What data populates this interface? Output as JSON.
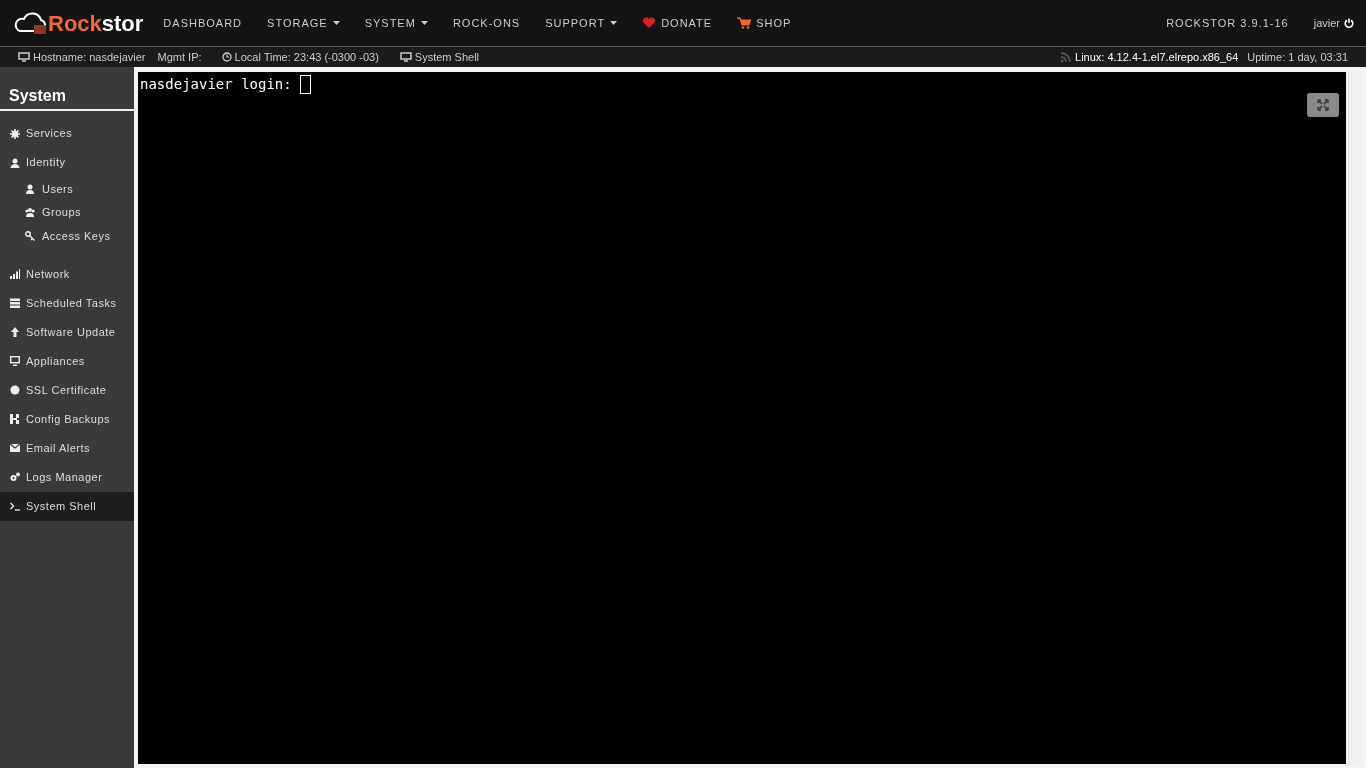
{
  "brand": {
    "name_part_1": "Rock",
    "name_part_2": "stor"
  },
  "nav": [
    {
      "label": "DASHBOARD",
      "has_menu": false
    },
    {
      "label": "STORAGE",
      "has_menu": true
    },
    {
      "label": "SYSTEM",
      "has_menu": true
    },
    {
      "label": "ROCK-ONS",
      "has_menu": false
    },
    {
      "label": "SUPPORT",
      "has_menu": true
    },
    {
      "label": "DONATE",
      "has_menu": false
    },
    {
      "label": "SHOP",
      "has_menu": false
    }
  ],
  "version": "ROCKSTOR 3.9.1-16",
  "user": "javier",
  "status_bar": {
    "hostname": "Hostname: nasdejavier",
    "mgmt_ip": "Mgmt IP:",
    "local_time": "Local Time: 23:43 (-0300 -03)",
    "shell": "System Shell",
    "kernel": "Linux: 4.12.4-1.el7.elrepo.x86_64",
    "uptime": "Uptime: 1 day, 03:31"
  },
  "sidebar": {
    "title": "System",
    "items": [
      {
        "label": "Services",
        "selected": false
      },
      {
        "label": "Identity",
        "selected": false,
        "children": [
          {
            "label": "Users",
            "selected": false
          },
          {
            "label": "Groups",
            "selected": false
          },
          {
            "label": "Access Keys",
            "selected": false
          }
        ]
      },
      {
        "label": "Network",
        "selected": false
      },
      {
        "label": "Scheduled Tasks",
        "selected": false
      },
      {
        "label": "Software Update",
        "selected": false
      },
      {
        "label": "Appliances",
        "selected": false
      },
      {
        "label": "SSL Certificate",
        "selected": false
      },
      {
        "label": "Config Backups",
        "selected": false
      },
      {
        "label": "Email Alerts",
        "selected": false
      },
      {
        "label": "Logs Manager",
        "selected": false
      },
      {
        "label": "System Shell",
        "selected": true
      }
    ]
  },
  "terminal": {
    "prompt": "nasdejavier login:"
  }
}
